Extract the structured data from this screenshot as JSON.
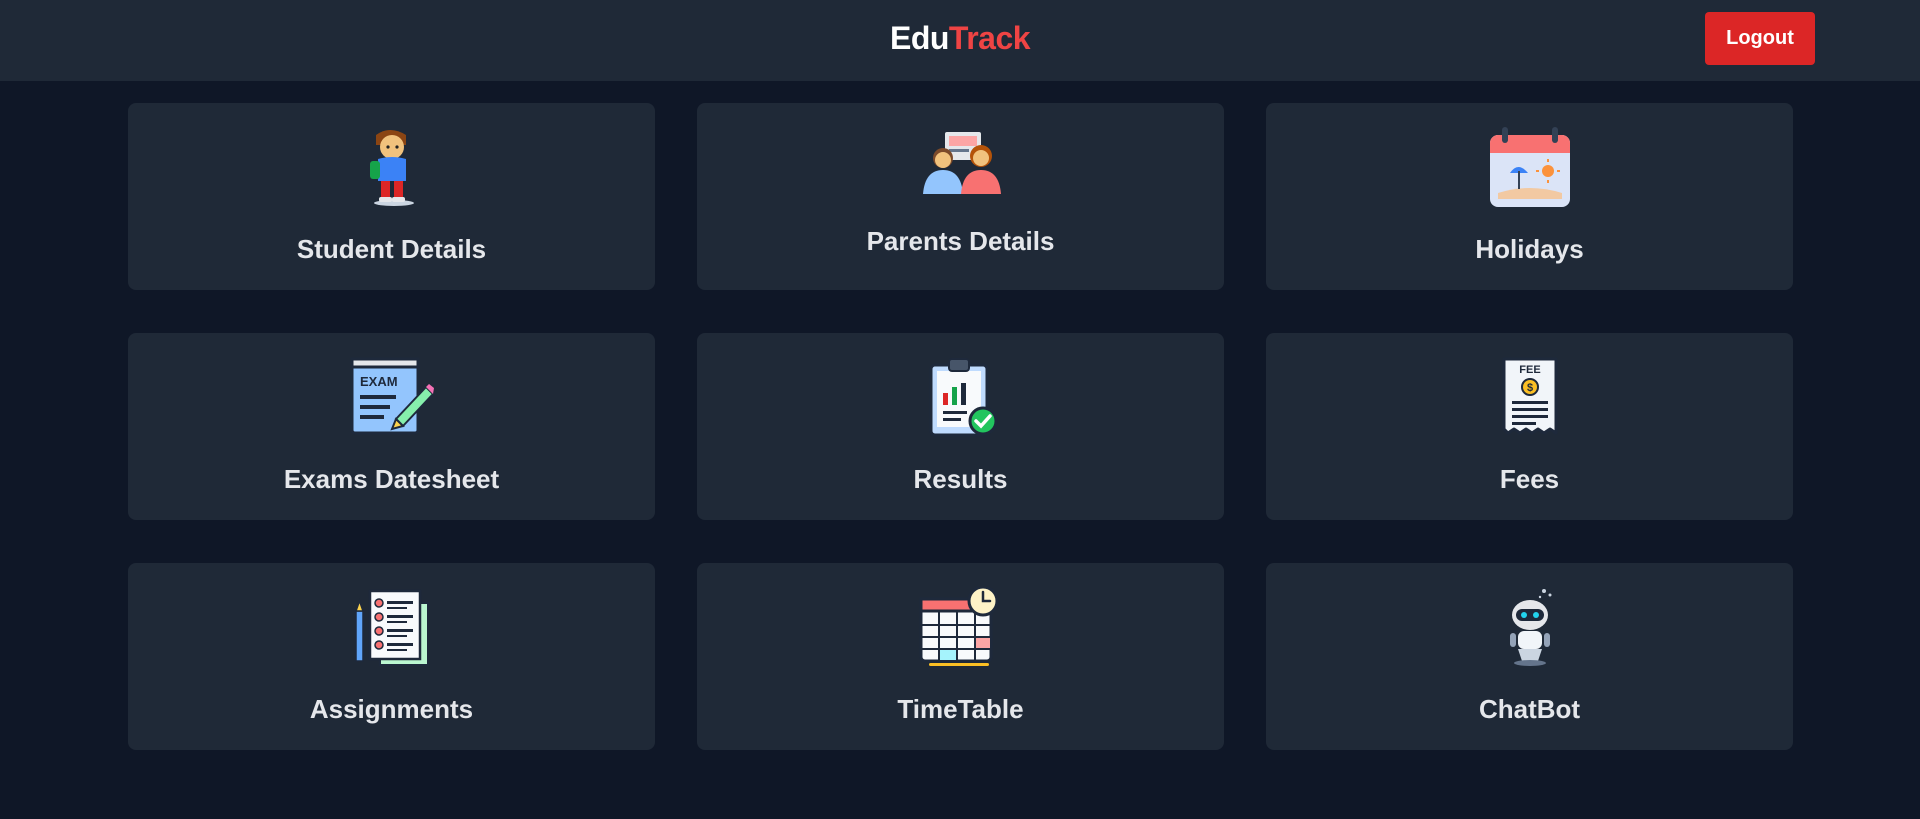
{
  "header": {
    "brand_first": "Edu",
    "brand_second": "Track",
    "logout_label": "Logout"
  },
  "colors": {
    "header_bg": "#1f2937",
    "page_bg": "#0f1727",
    "card_bg": "#1f2937",
    "accent_red": "#ef4444",
    "logout_bg": "#dc2626"
  },
  "cards": [
    {
      "label": "Student Details",
      "icon": "student-icon"
    },
    {
      "label": "Parents Details",
      "icon": "parents-icon"
    },
    {
      "label": "Holidays",
      "icon": "holiday-calendar-icon"
    },
    {
      "label": "Exams Datesheet",
      "icon": "exam-icon"
    },
    {
      "label": "Results",
      "icon": "results-clipboard-icon"
    },
    {
      "label": "Fees",
      "icon": "fee-receipt-icon"
    },
    {
      "label": "Assignments",
      "icon": "assignment-checklist-icon"
    },
    {
      "label": "TimeTable",
      "icon": "timetable-icon"
    },
    {
      "label": "ChatBot",
      "icon": "robot-icon"
    }
  ],
  "icon_text": {
    "exam": "EXAM",
    "fee": "FEE",
    "fee_symbol": "$"
  }
}
